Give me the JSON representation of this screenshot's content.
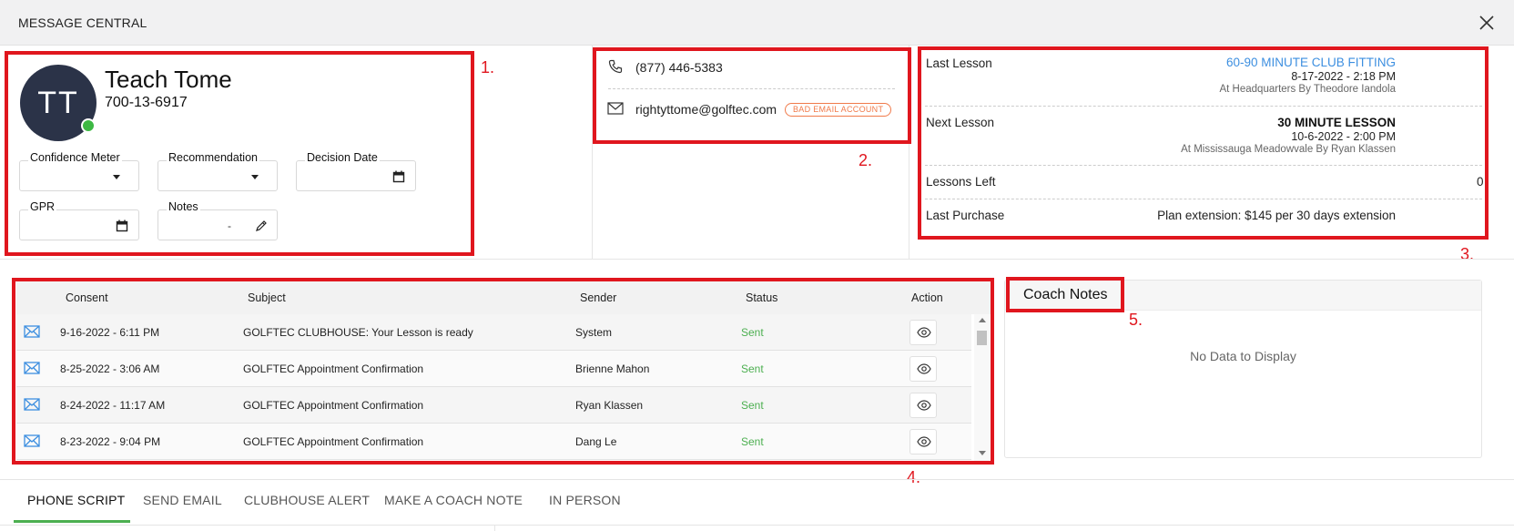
{
  "window": {
    "title": "MESSAGE CENTRAL"
  },
  "annotations": {
    "n1": "1.",
    "n2": "2.",
    "n3": "3.",
    "n4": "4.",
    "n5": "5."
  },
  "profile": {
    "initials": "TT",
    "name": "Teach Tome",
    "id": "700-13-6917",
    "fields": {
      "confidence_meter": "Confidence Meter",
      "recommendation": "Recommendation",
      "decision_date": "Decision Date",
      "gpr": "GPR",
      "notes": "Notes",
      "notes_value": "-"
    }
  },
  "contact": {
    "phone": "(877) 446-5383",
    "email": "rightyttome@golftec.com",
    "email_badge": "BAD EMAIL ACCOUNT"
  },
  "lessons": {
    "last_lesson": {
      "label": "Last Lesson",
      "title": "60-90 MINUTE CLUB FITTING",
      "datetime": "8-17-2022 - 2:18 PM",
      "location": "At Headquarters By Theodore Iandola"
    },
    "next_lesson": {
      "label": "Next Lesson",
      "title": "30 MINUTE LESSON",
      "datetime": "10-6-2022 - 2:00 PM",
      "location": "At Mississauga Meadowvale By Ryan Klassen"
    },
    "lessons_left": {
      "label": "Lessons Left",
      "value": "0"
    },
    "last_purchase": {
      "label": "Last Purchase",
      "value": "Plan extension: $145 per 30 days extension"
    }
  },
  "messages": {
    "columns": {
      "consent": "Consent",
      "subject": "Subject",
      "sender": "Sender",
      "status": "Status",
      "action": "Action"
    },
    "rows": [
      {
        "date": "9-16-2022 - 6:11 PM",
        "subject": "GOLFTEC CLUBHOUSE: Your Lesson is ready",
        "sender": "System",
        "status": "Sent"
      },
      {
        "date": "8-25-2022 - 3:06 AM",
        "subject": "GOLFTEC Appointment Confirmation",
        "sender": "Brienne Mahon",
        "status": "Sent"
      },
      {
        "date": "8-24-2022 - 11:17 AM",
        "subject": "GOLFTEC Appointment Confirmation",
        "sender": "Ryan Klassen",
        "status": "Sent"
      },
      {
        "date": "8-23-2022 - 9:04 PM",
        "subject": "GOLFTEC Appointment Confirmation",
        "sender": "Dang Le",
        "status": "Sent"
      }
    ]
  },
  "coach_notes": {
    "title": "Coach Notes",
    "empty": "No Data to Display"
  },
  "tabs": [
    {
      "label": "PHONE SCRIPT"
    },
    {
      "label": "SEND EMAIL"
    },
    {
      "label": "CLUBHOUSE ALERT"
    },
    {
      "label": "MAKE A COACH NOTE"
    },
    {
      "label": "IN PERSON"
    }
  ],
  "colors": {
    "annotation_red": "#e0161e",
    "accent_green": "#4caf50",
    "link_blue": "#3d8fe0",
    "badge_orange": "#f07a4a",
    "avatar_bg": "#2b3348"
  }
}
